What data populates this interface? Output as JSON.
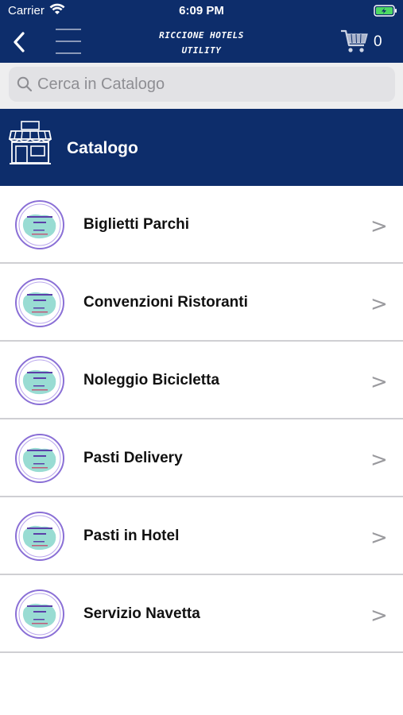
{
  "status": {
    "carrier": "Carrier",
    "time": "6:09 PM"
  },
  "nav": {
    "title_line1": "RICCIONE HOTELS",
    "title_line2": "UTILITY",
    "cart_count": "0"
  },
  "search": {
    "placeholder": "Cerca in Catalogo"
  },
  "catalog": {
    "title": "Catalogo",
    "items": [
      {
        "label": "Biglietti Parchi",
        "chevron": ">"
      },
      {
        "label": "Convenzioni Ristoranti",
        "chevron": ">"
      },
      {
        "label": "Noleggio Bicicletta",
        "chevron": ">"
      },
      {
        "label": "Pasti Delivery",
        "chevron": ">"
      },
      {
        "label": "Pasti in Hotel",
        "chevron": ">"
      },
      {
        "label": "Servizio Navetta",
        "chevron": ">"
      }
    ]
  },
  "colors": {
    "nav_bg": "#0d2d6b",
    "battery": "#4cd964",
    "thumb_ring": "#8a6fd6",
    "thumb_fill": "#7fd3c8"
  }
}
